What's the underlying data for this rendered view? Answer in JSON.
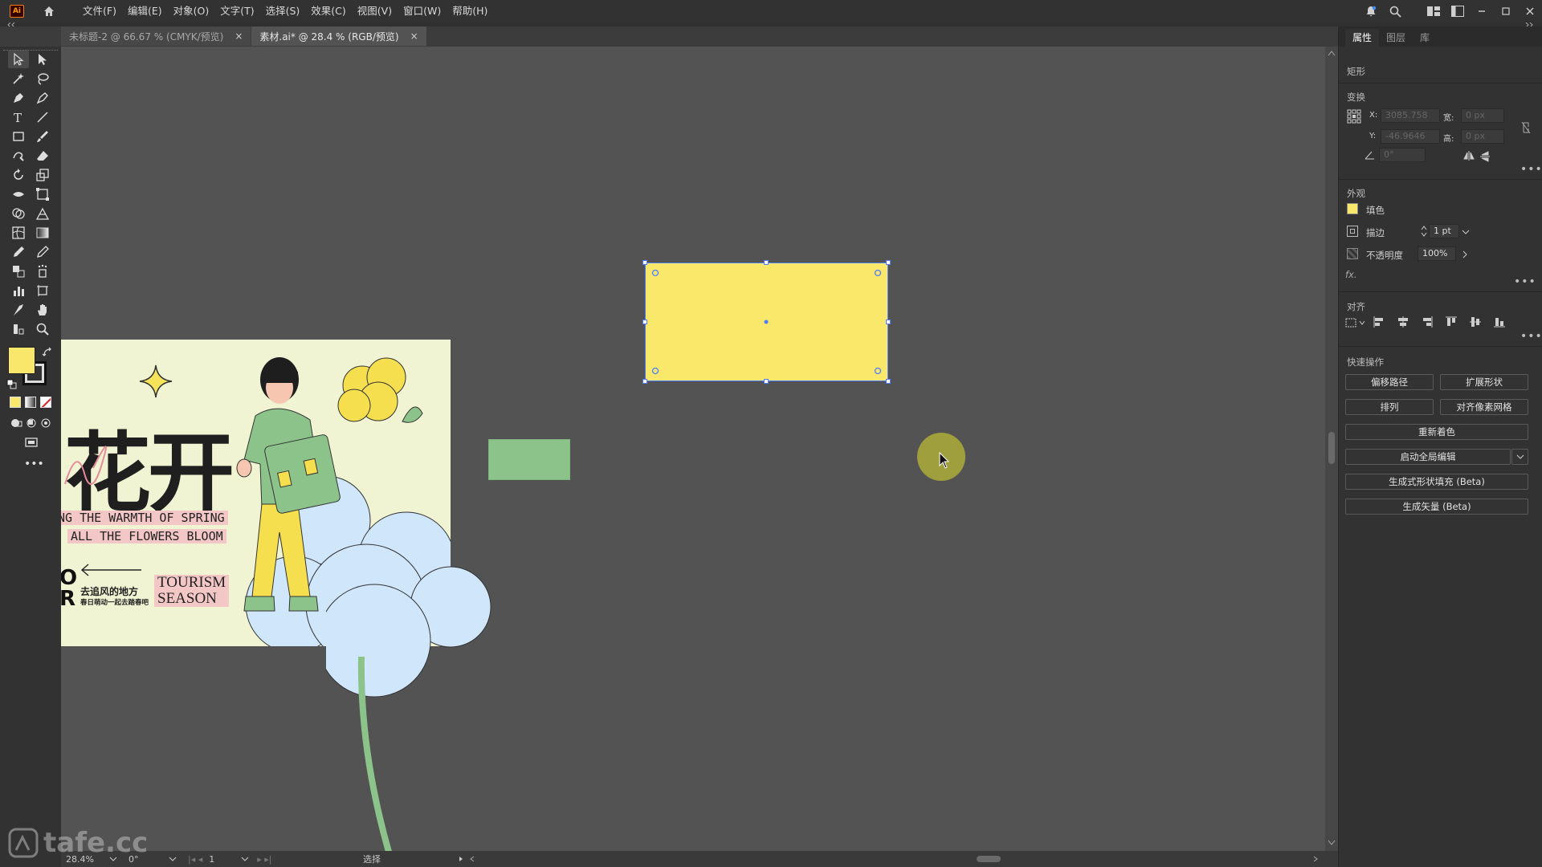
{
  "app": {
    "logo_text": "Ai",
    "menus": [
      "文件(F)",
      "编辑(E)",
      "对象(O)",
      "文字(T)",
      "选择(S)",
      "效果(C)",
      "视图(V)",
      "窗口(W)",
      "帮助(H)"
    ]
  },
  "tabs": [
    {
      "label": "未标题-2 @ 66.67 % (CMYK/预览)",
      "close": "×",
      "active": false
    },
    {
      "label": "素材.ai* @ 28.4 % (RGB/预览)",
      "close": "×",
      "active": true
    }
  ],
  "colors": {
    "fill_swatch": "#f8e76a",
    "yellow_rect": "#f9e86a",
    "green_rect": "#8cc38b",
    "selection": "#4f7bff",
    "artboard_bg": "#f0f4d2"
  },
  "artwork": {
    "big_title": "花开",
    "line1": "NG THE WARMTH OF SPRING",
    "line2": "ALL THE FLOWERS BLOOM",
    "tourism": "TOURISM",
    "season": "SEASON",
    "cn_line1": "去追风的地方",
    "cn_line2": "春日萌动一起去踏春吧",
    "or_letters": "O\nR"
  },
  "status": {
    "zoom": "28.4%",
    "rotate": "0°",
    "artboard_num": "1",
    "tool_name": "选择"
  },
  "panel": {
    "tabs": [
      "属性",
      "图层",
      "库"
    ],
    "object_type": "矩形",
    "transform": {
      "title": "变换",
      "x_label": "X:",
      "y_label": "Y:",
      "w_label": "宽:",
      "h_label": "高:",
      "x_value": "3085.758",
      "y_value": "-46.9646",
      "w_value": "0 px",
      "h_value": "0 px",
      "angle_value": "0°"
    },
    "appearance": {
      "title": "外观",
      "fill_label": "填色",
      "stroke_label": "描边",
      "stroke_value": "1 pt",
      "opacity_label": "不透明度",
      "opacity_value": "100%",
      "fx_label": "fx."
    },
    "align": {
      "title": "对齐"
    },
    "quick_actions": {
      "title": "快速操作",
      "offset_path": "偏移路径",
      "expand_shape": "扩展形状",
      "arrange": "排列",
      "align_pixel": "对齐像素网格",
      "recolor": "重新着色",
      "global_edit": "启动全局编辑",
      "gen_shape_fill": "生成式形状填充 (Beta)",
      "gen_vector": "生成矢量 (Beta)"
    },
    "more": "•••"
  },
  "watermark": "tafe.cc"
}
